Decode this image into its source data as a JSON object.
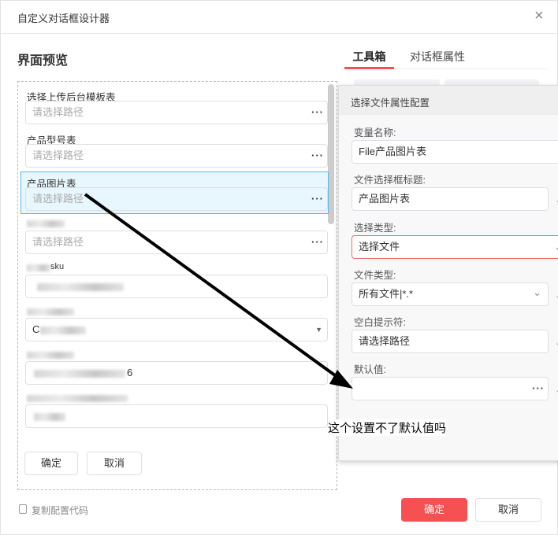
{
  "dialog": {
    "title": "自定义对话框设计器",
    "close_icon": "close-icon"
  },
  "preview": {
    "title": "界面预览",
    "fields": [
      {
        "label": "选择上传后台模板表",
        "placeholder": "请选择路径"
      },
      {
        "label": "产品型号表",
        "placeholder": "请选择路径"
      },
      {
        "label": "产品图片表",
        "placeholder": "请选择路径"
      },
      {
        "label": "",
        "placeholder": "请选择路径"
      }
    ],
    "blurred_label_fragment": "sku",
    "blurred_select_fragment": "C",
    "blurred_value_fragment": "6",
    "ok": "确定",
    "cancel": "取消"
  },
  "tabs": [
    {
      "label": "工具箱",
      "active": true
    },
    {
      "label": "对话框属性",
      "active": false
    }
  ],
  "accent": "#f55052",
  "props": {
    "title": "选择文件属性配置",
    "var_name": {
      "label": "变量名称:",
      "value": "File产品图片表"
    },
    "dialog_title": {
      "label": "文件选择框标题:",
      "value": "产品图片表"
    },
    "select_type": {
      "label": "选择类型:",
      "value": "选择文件"
    },
    "file_type": {
      "label": "文件类型:",
      "value": "所有文件|*.*"
    },
    "placeholder": {
      "label": "空白提示符:",
      "value": "请选择路径"
    },
    "default": {
      "label": "默认值:",
      "value": ""
    }
  },
  "annotation": "这个设置不了默认值吗",
  "footer": {
    "copy": "复制配置代码",
    "ok": "确定",
    "cancel": "取消"
  }
}
